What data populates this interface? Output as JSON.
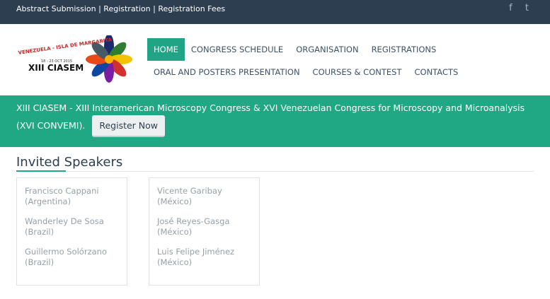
{
  "topbar": {
    "links": "Abstract Submission | Registration | Registration Fees",
    "facebook_glyph": "f",
    "twitter_glyph": "t"
  },
  "logo": {
    "top_text": "VENEZUELA - ISLA DE MARGARITA",
    "date_text": "18 - 23 OCT 2015",
    "name_text": "XIII CIASEM"
  },
  "nav": {
    "row1": [
      "HOME",
      "CONGRESS SCHEDULE",
      "ORGANISATION",
      "REGISTRATIONS"
    ],
    "row2": [
      "ORAL AND POSTERS PRESENTATION",
      "COURSES & CONTEST",
      "CONTACTS"
    ]
  },
  "banner": {
    "text": "XIII CIASEM - XIII Interamerican Microscopy Congress  &   XVI Venezuelan Congress for Microscopy and Microanalysis (XVI CONVEMI).",
    "button": "Register Now"
  },
  "section": {
    "title": "Invited Speakers"
  },
  "speakers": {
    "col1": [
      {
        "name": "Francisco Cappani",
        "country": "(Argentina)"
      },
      {
        "name": "Wanderley De Sosa",
        "country": "(Brazil)"
      },
      {
        "name": "Guillermo Solórzano",
        "country": "(Brazil)"
      }
    ],
    "col2": [
      {
        "name": "Vicente Garibay",
        "country": "(México)"
      },
      {
        "name": "José Reyes-Gasga",
        "country": "(México)"
      },
      {
        "name": "Luis Felipe Jiménez",
        "country": "(México)"
      }
    ]
  },
  "colors": {
    "topbar": "#2d3e50",
    "accent": "#1fa883",
    "nav_text": "#3d5166"
  }
}
